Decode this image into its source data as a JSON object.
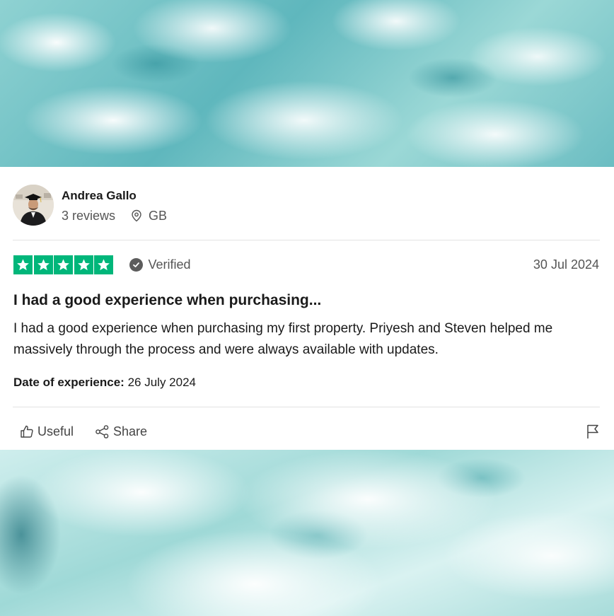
{
  "reviewer": {
    "name": "Andrea Gallo",
    "reviews_count": "3 reviews",
    "country": "GB"
  },
  "review": {
    "rating_stars": 5,
    "verified_label": "Verified",
    "date": "30 Jul 2024",
    "title": "I had a good experience when purchasing...",
    "body": "I had a good experience when purchasing my first property. Priyesh and Steven helped me massively through the process and were always available with updates.",
    "experience_label": "Date of experience:",
    "experience_date": "26 July 2024"
  },
  "actions": {
    "useful_label": "Useful",
    "share_label": "Share"
  },
  "colors": {
    "star_green": "#00b67a",
    "text_dark": "#1a1a1a",
    "text_muted": "#555555"
  },
  "icons": [
    "location-pin-icon",
    "star-icon",
    "verified-check-icon",
    "thumbs-up-icon",
    "share-icon",
    "flag-icon"
  ]
}
